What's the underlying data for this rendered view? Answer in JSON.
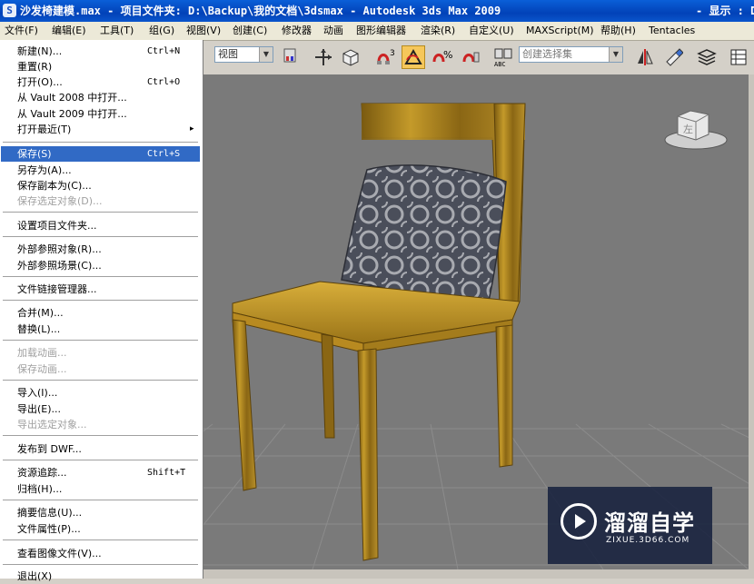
{
  "titlebar": {
    "text": "沙发椅建模.max   - 项目文件夹: D:\\Backup\\我的文档\\3dsmax   - Autodesk 3ds Max  2009",
    "right_text": "- 显示 : D"
  },
  "menubar": {
    "items": [
      "文件(F)",
      "编辑(E)",
      "工具(T)",
      "组(G)",
      "视图(V)",
      "创建(C)",
      "修改器",
      "动画",
      "图形编辑器",
      "渲染(R)",
      "自定义(U)",
      "MAXScript(M)",
      "帮助(H)",
      "Tentacles"
    ]
  },
  "toolbar": {
    "view_combo": "视图",
    "selection_set_combo": "创建选择集",
    "snap_label": "3",
    "angle_snap_label": "%"
  },
  "file_menu": {
    "items": [
      {
        "label": "新建(N)...",
        "shortcut": "Ctrl+N"
      },
      {
        "label": "重置(R)",
        "shortcut": ""
      },
      {
        "label": "打开(O)...",
        "shortcut": "Ctrl+O"
      },
      {
        "label": "从 Vault 2008 中打开...",
        "shortcut": ""
      },
      {
        "label": "从 Vault 2009 中打开...",
        "shortcut": ""
      },
      {
        "label": "打开最近(T)",
        "shortcut": "",
        "submenu": "▸"
      },
      {
        "label": "保存(S)",
        "shortcut": "Ctrl+S",
        "selected": true
      },
      {
        "label": "另存为(A)...",
        "shortcut": ""
      },
      {
        "label": "保存副本为(C)...",
        "shortcut": ""
      },
      {
        "label": "保存选定对象(D)...",
        "shortcut": "",
        "disabled": true
      },
      {
        "label": "设置项目文件夹...",
        "shortcut": ""
      },
      {
        "label": "外部参照对象(R)...",
        "shortcut": ""
      },
      {
        "label": "外部参照场景(C)...",
        "shortcut": ""
      },
      {
        "label": "文件链接管理器...",
        "shortcut": ""
      },
      {
        "label": "合并(M)...",
        "shortcut": ""
      },
      {
        "label": "替换(L)...",
        "shortcut": ""
      },
      {
        "label": "加载动画...",
        "shortcut": "",
        "disabled": true
      },
      {
        "label": "保存动画...",
        "shortcut": "",
        "disabled": true
      },
      {
        "label": "导入(I)...",
        "shortcut": ""
      },
      {
        "label": "导出(E)...",
        "shortcut": ""
      },
      {
        "label": "导出选定对象...",
        "shortcut": "",
        "disabled": true
      },
      {
        "label": "发布到 DWF...",
        "shortcut": ""
      },
      {
        "label": "资源追踪...",
        "shortcut": "Shift+T"
      },
      {
        "label": "归档(H)...",
        "shortcut": ""
      },
      {
        "label": "摘要信息(U)...",
        "shortcut": ""
      },
      {
        "label": "文件属性(P)...",
        "shortcut": ""
      },
      {
        "label": "查看图像文件(V)...",
        "shortcut": ""
      },
      {
        "label": "退出(X)",
        "shortcut": ""
      }
    ]
  },
  "viewcube": {
    "label": "左"
  },
  "watermark": {
    "title": "溜溜自学",
    "url": "ZIXUE.3D66.COM"
  },
  "colors": {
    "titlebar": "#0a4fcf",
    "menu_highlight": "#316ac5",
    "active_tool": "#f6c75a",
    "viewport_bg": "#7a7a7a",
    "wood": "#a07818",
    "pillow": "#4a4e5a"
  }
}
